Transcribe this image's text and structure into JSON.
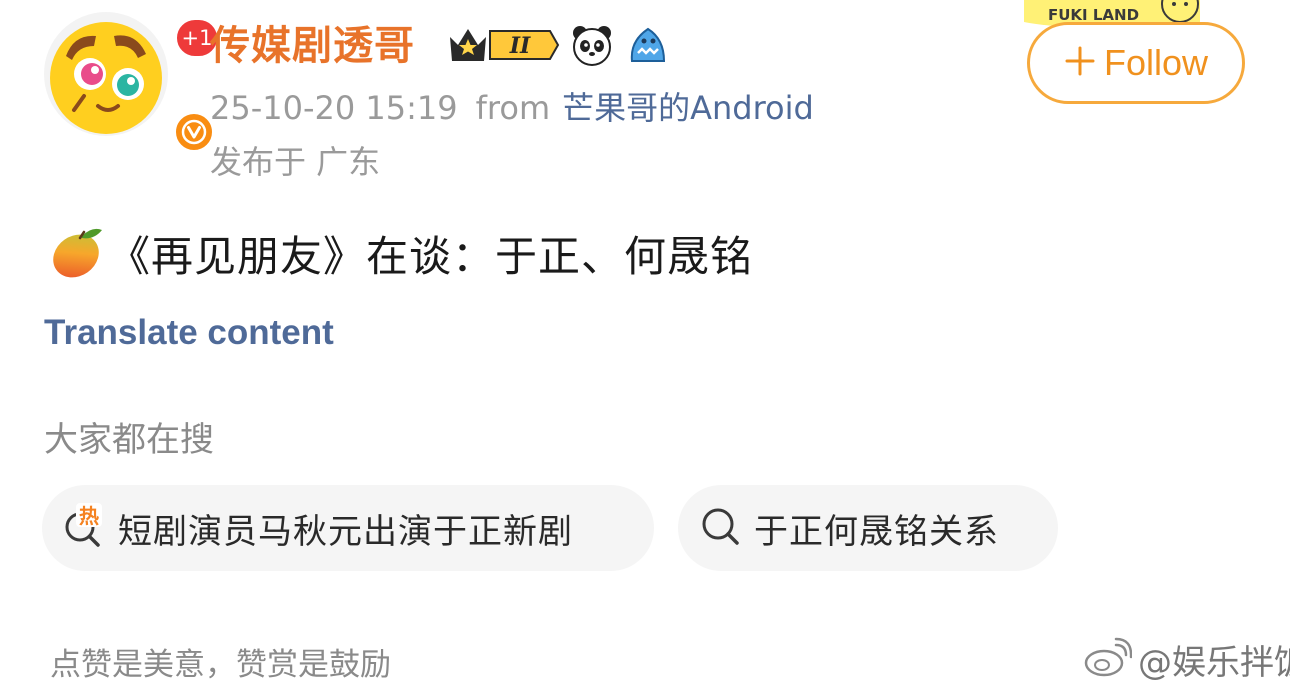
{
  "author": {
    "name": "传媒剧透哥",
    "notification_count": "+1",
    "level_badge": "II",
    "verified_mark": "V"
  },
  "post_meta": {
    "timestamp": "25-10-20 15:19",
    "from_label": "from",
    "source_app": "芒果哥的Android",
    "location": "发布于 广东"
  },
  "follow": {
    "label": "Follow",
    "sticker_text": "FUKI LAND"
  },
  "post": {
    "emoji_icon": "mango-icon",
    "text": "《再见朋友》在谈：于正、何晟铭"
  },
  "translate": {
    "label": "Translate content"
  },
  "trending": {
    "heading": "大家都在搜",
    "hot_marker": "热",
    "chips": [
      {
        "label": "短剧演员马秋元出演于正新剧",
        "icon": "hot-search-icon"
      },
      {
        "label": "于正何晟铭关系",
        "icon": "search-icon"
      }
    ]
  },
  "footer": {
    "text": "点赞是美意，赞赏是鼓励"
  },
  "watermark": {
    "text": "@娱乐拌饭"
  },
  "colors": {
    "username": "#e8732a",
    "link": "#4f6a98",
    "follow_accent": "#f0911e",
    "muted": "#9a9a9a",
    "chip_bg": "#f5f5f5"
  }
}
